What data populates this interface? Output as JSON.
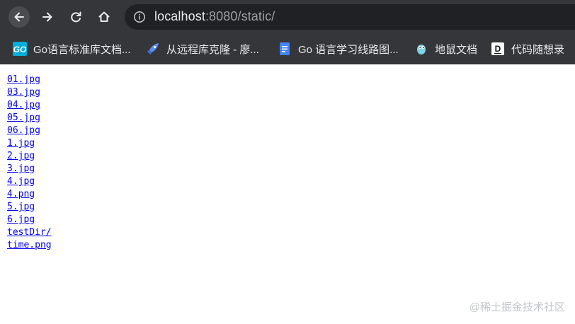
{
  "toolbar": {
    "back_icon": "arrow-left-icon",
    "forward_icon": "arrow-right-icon",
    "reload_icon": "reload-icon",
    "home_icon": "home-icon"
  },
  "address_bar": {
    "host": "localhost",
    "rest": ":8080/static/",
    "info_icon": "info-icon"
  },
  "bookmarks": [
    {
      "label": "Go语言标准库文档...",
      "icon": "go-logo-icon"
    },
    {
      "label": "从远程库克隆 - 廖...",
      "icon": "rocket-icon"
    },
    {
      "label": "Go 语言学习线路图...",
      "icon": "document-icon"
    },
    {
      "label": "地鼠文档",
      "icon": "gopher-icon"
    },
    {
      "label": "代码随想录",
      "icon": "d-logo-icon"
    }
  ],
  "files": [
    "01.jpg",
    "03.jpg",
    "04.jpg",
    "05.jpg",
    "06.jpg",
    "1.jpg",
    "2.jpg",
    "3.jpg",
    "4.jpg",
    "4.png",
    "5.jpg",
    "6.jpg",
    "testDir/",
    "time.png"
  ],
  "watermark": "@稀土掘金技术社区",
  "colors": {
    "chrome": "#35363a",
    "omnibox": "#202124",
    "link": "#0000ee"
  }
}
